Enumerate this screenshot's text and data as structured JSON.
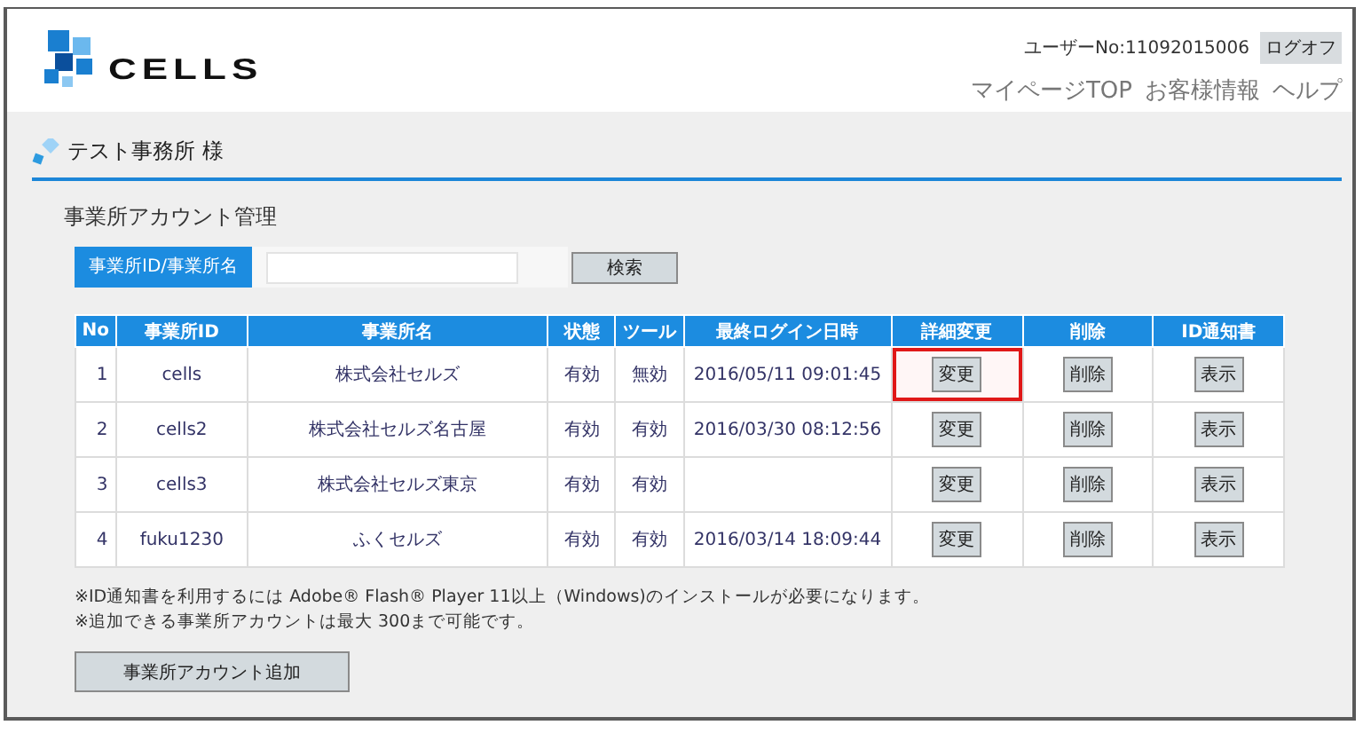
{
  "header": {
    "logo_text": "CELLS",
    "user_no": "ユーザーNo:11092015006",
    "logout": "ログオフ",
    "nav": [
      "マイページTOP",
      "お客様情報",
      "ヘルプ"
    ]
  },
  "page_title": "テスト事務所 様",
  "section_title": "事業所アカウント管理",
  "search": {
    "label": "事業所ID/事業所名",
    "button": "検索"
  },
  "table": {
    "columns": [
      "No",
      "事業所ID",
      "事業所名",
      "状態",
      "ツール",
      "最終ログイン日時",
      "詳細変更",
      "削除",
      "ID通知書"
    ],
    "rows": [
      {
        "no": "1",
        "id": "cells",
        "name": "株式会社セルズ",
        "status": "有効",
        "tool": "無効",
        "last_login": "2016/05/11 09:01:45",
        "edit": "変更",
        "delete": "削除",
        "notice": "表示",
        "highlighted": true
      },
      {
        "no": "2",
        "id": "cells2",
        "name": "株式会社セルズ名古屋",
        "status": "有効",
        "tool": "有効",
        "last_login": "2016/03/30 08:12:56",
        "edit": "変更",
        "delete": "削除",
        "notice": "表示",
        "highlighted": false
      },
      {
        "no": "3",
        "id": "cells3",
        "name": "株式会社セルズ東京",
        "status": "有効",
        "tool": "有効",
        "edit": "変更",
        "delete": "削除",
        "notice": "表示",
        "highlighted": false
      },
      {
        "no": "4",
        "id": "fuku1230",
        "name": "ふくセルズ",
        "status": "有効",
        "tool": "有効",
        "last_login": "2016/03/14 18:09:44",
        "edit": "変更",
        "delete": "削除",
        "notice": "表示",
        "highlighted": false
      }
    ]
  },
  "notes": [
    "※ID通知書を利用するには Adobe® Flash® Player 11以上（Windows)のインストールが必要になります。",
    "※追加できる事業所アカウントは最大 300まで可能です。"
  ],
  "add_button": "事業所アカウント追加"
}
